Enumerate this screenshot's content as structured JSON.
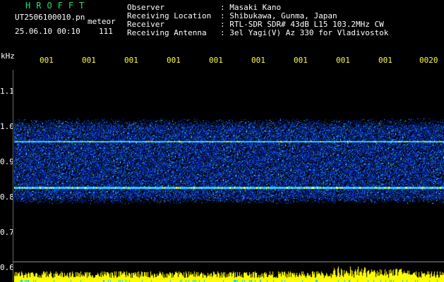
{
  "header": {
    "app_title": "HROFFT",
    "file_name": "UT2506100010.pn",
    "meteor_label": "meteor",
    "datetime": "25.06.10 00:10",
    "count": "111"
  },
  "meta": [
    {
      "key": "Observer",
      "value": ": Masaki Kano"
    },
    {
      "key": "Receiving Location",
      "value": ": Shibukawa, Gunma, Japan"
    },
    {
      "key": "Receiver",
      "value": ": RTL-SDR SDR# 43dB L15 103.2MHz CW"
    },
    {
      "key": "Receiving Antenna",
      "value": ": 3el Yagi(V) Az 330 for Vladivostok"
    }
  ],
  "y_axis": {
    "unit": "kHz",
    "ticks": [
      {
        "label": "1.1",
        "value": 1.1
      },
      {
        "label": "1.0",
        "value": 1.0
      },
      {
        "label": "0.9",
        "value": 0.9
      },
      {
        "label": "0.8",
        "value": 0.8
      },
      {
        "label": "0.7",
        "value": 0.7
      },
      {
        "label": "0.6",
        "value": 0.6
      }
    ]
  },
  "x_axis": {
    "ticks": [
      "001",
      "001",
      "001",
      "001",
      "001",
      "001",
      "001",
      "001",
      "001",
      "0020"
    ]
  },
  "spectrogram": {
    "noise_band_khz": [
      0.8,
      1.0
    ],
    "signal_lines_khz": [
      0.96,
      0.83
    ],
    "colors": {
      "background": "#000000",
      "noise": "#1838c8",
      "signal": "#40c8ff",
      "peak": "#ffff40",
      "bars": "#ffff00",
      "cyan": "#00d8ff"
    }
  }
}
